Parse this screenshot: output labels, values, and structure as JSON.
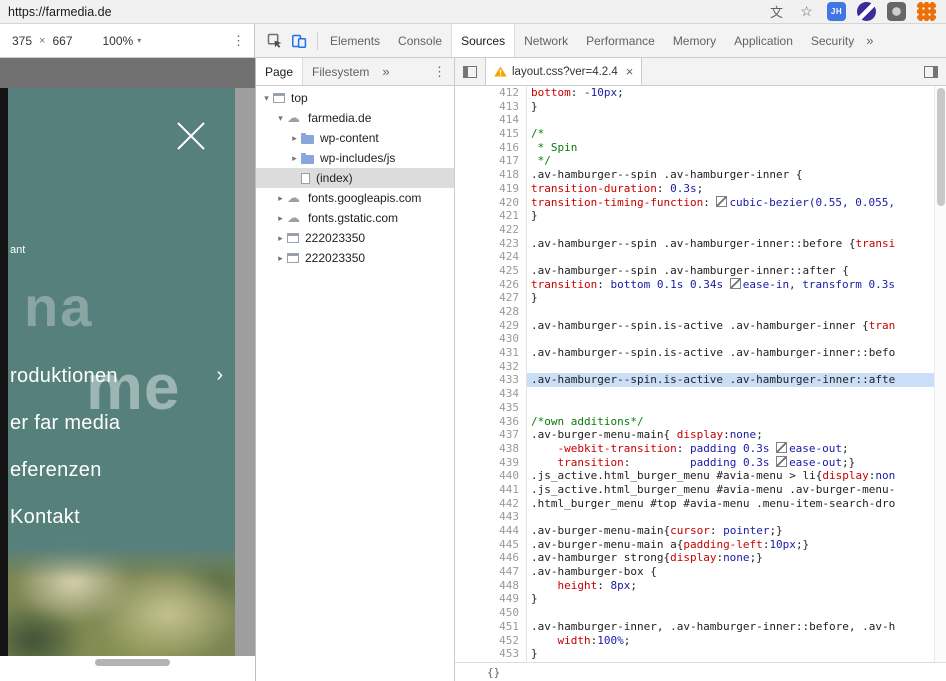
{
  "browser": {
    "url": "https://farmedia.de",
    "icons": [
      {
        "name": "translate-icon",
        "glyph": "文"
      },
      {
        "name": "star-icon",
        "glyph": "☆"
      },
      {
        "name": "extension-icon-jh",
        "glyph": "JH"
      },
      {
        "name": "extension-icon-purple",
        "glyph": ""
      },
      {
        "name": "extension-icon-gray",
        "glyph": ""
      },
      {
        "name": "extension-icon-orange",
        "glyph": ""
      }
    ]
  },
  "glyphs": {
    "times": "×",
    "caret": "▾",
    "kebab": "⋮",
    "overflow": "»",
    "close": "×",
    "chevron": "›",
    "expander_open": "▾",
    "expander_closed": "▸"
  },
  "device_toolbar": {
    "width": "375",
    "height": "667",
    "zoom": "100%"
  },
  "devtools": {
    "tabs": [
      "Elements",
      "Console",
      "Sources",
      "Network",
      "Performance",
      "Memory",
      "Application",
      "Security"
    ],
    "active_tab": "Sources"
  },
  "sidebar": {
    "tabs": [
      "Page",
      "Filesystem"
    ],
    "active_tab": "Page",
    "tree": [
      {
        "label": "top",
        "icon": "frame",
        "depth": 0,
        "exp": "open"
      },
      {
        "label": "farmedia.de",
        "icon": "cloud",
        "depth": 1,
        "exp": "open"
      },
      {
        "label": "wp-content",
        "icon": "folder",
        "depth": 2,
        "exp": "closed"
      },
      {
        "label": "wp-includes/js",
        "icon": "folder",
        "depth": 2,
        "exp": "closed"
      },
      {
        "label": "(index)",
        "icon": "page",
        "depth": 2,
        "exp": "",
        "selected": true
      },
      {
        "label": "fonts.googleapis.com",
        "icon": "cloud",
        "depth": 1,
        "exp": "closed"
      },
      {
        "label": "fonts.gstatic.com",
        "icon": "cloud",
        "depth": 1,
        "exp": "closed"
      },
      {
        "label": "222023350",
        "icon": "frame",
        "depth": 1,
        "exp": "closed"
      },
      {
        "label": "222023350",
        "icon": "frame",
        "depth": 1,
        "exp": "closed"
      }
    ]
  },
  "editor": {
    "tab": {
      "label": "layout.css?ver=4.2.4"
    },
    "pretty_print_label": "{}",
    "lines": [
      {
        "n": 412,
        "t": [
          [
            "k",
            "bottom"
          ],
          [
            "p",
            ": "
          ],
          [
            "v",
            "-10px"
          ],
          [
            "p",
            ";"
          ]
        ]
      },
      {
        "n": 413,
        "t": [
          [
            "p",
            "}"
          ]
        ]
      },
      {
        "n": 414,
        "t": []
      },
      {
        "n": 415,
        "t": [
          [
            "c",
            "/*"
          ]
        ]
      },
      {
        "n": 416,
        "t": [
          [
            "c",
            " * Spin"
          ]
        ]
      },
      {
        "n": 417,
        "t": [
          [
            "c",
            " */"
          ]
        ]
      },
      {
        "n": 418,
        "t": [
          [
            "p",
            ".av-hamburger--spin .av-hamburger-inner {"
          ]
        ]
      },
      {
        "n": 419,
        "t": [
          [
            "k",
            "transition-duration"
          ],
          [
            "p",
            ": "
          ],
          [
            "v",
            "0.3s"
          ],
          [
            "p",
            ";"
          ]
        ]
      },
      {
        "n": 420,
        "t": [
          [
            "k",
            "transition-timing-function"
          ],
          [
            "p",
            ": "
          ],
          [
            "sw",
            ""
          ],
          [
            "v",
            "cubic-bezier(0.55, 0.055,"
          ]
        ]
      },
      {
        "n": 421,
        "t": [
          [
            "p",
            "}"
          ]
        ]
      },
      {
        "n": 422,
        "t": []
      },
      {
        "n": 423,
        "t": [
          [
            "p",
            ".av-hamburger--spin .av-hamburger-inner::before {"
          ],
          [
            "k",
            "transi"
          ]
        ]
      },
      {
        "n": 424,
        "t": []
      },
      {
        "n": 425,
        "t": [
          [
            "p",
            ".av-hamburger--spin .av-hamburger-inner::after {"
          ]
        ]
      },
      {
        "n": 426,
        "t": [
          [
            "k",
            "transition"
          ],
          [
            "p",
            ": "
          ],
          [
            "v",
            "bottom 0.1s 0.34s "
          ],
          [
            "sw",
            ""
          ],
          [
            "v",
            "ease-in, transform 0.3s"
          ]
        ]
      },
      {
        "n": 427,
        "t": [
          [
            "p",
            "}"
          ]
        ]
      },
      {
        "n": 428,
        "t": []
      },
      {
        "n": 429,
        "t": [
          [
            "p",
            ".av-hamburger--spin.is-active .av-hamburger-inner {"
          ],
          [
            "k",
            "tran"
          ]
        ]
      },
      {
        "n": 430,
        "t": []
      },
      {
        "n": 431,
        "t": [
          [
            "p",
            ".av-hamburger--spin.is-active .av-hamburger-inner::befo"
          ]
        ]
      },
      {
        "n": 432,
        "t": []
      },
      {
        "n": 433,
        "hl": true,
        "t": [
          [
            "p",
            ".av-hamburger--spin.is-active .av-hamburger-inner::afte"
          ]
        ]
      },
      {
        "n": 434,
        "t": []
      },
      {
        "n": 435,
        "t": []
      },
      {
        "n": 436,
        "t": [
          [
            "c",
            "/*own additions*/"
          ]
        ]
      },
      {
        "n": 437,
        "t": [
          [
            "p",
            ".av-burger-menu-main{ "
          ],
          [
            "k",
            "display"
          ],
          [
            "p",
            ":"
          ],
          [
            "v",
            "none"
          ],
          [
            "p",
            ";"
          ]
        ]
      },
      {
        "n": 438,
        "t": [
          [
            "p",
            "    "
          ],
          [
            "k",
            "-webkit-transition"
          ],
          [
            "p",
            ": "
          ],
          [
            "v",
            "padding 0.3s "
          ],
          [
            "sw",
            ""
          ],
          [
            "v",
            "ease-out"
          ],
          [
            "p",
            ";"
          ]
        ]
      },
      {
        "n": 439,
        "t": [
          [
            "p",
            "    "
          ],
          [
            "k",
            "transition"
          ],
          [
            "p",
            ":         "
          ],
          [
            "v",
            "padding 0.3s "
          ],
          [
            "sw",
            ""
          ],
          [
            "v",
            "ease-out"
          ],
          [
            "p",
            ";}"
          ]
        ]
      },
      {
        "n": 440,
        "t": [
          [
            "p",
            ".js_active.html_burger_menu #avia-menu > li{"
          ],
          [
            "k",
            "display"
          ],
          [
            "p",
            ":"
          ],
          [
            "v",
            "non"
          ]
        ]
      },
      {
        "n": 441,
        "t": [
          [
            "p",
            ".js_active.html_burger_menu #avia-menu .av-burger-menu-"
          ]
        ]
      },
      {
        "n": 442,
        "t": [
          [
            "p",
            ".html_burger_menu #top #avia-menu .menu-item-search-dro"
          ]
        ]
      },
      {
        "n": 443,
        "t": []
      },
      {
        "n": 444,
        "t": [
          [
            "p",
            ".av-burger-menu-main{"
          ],
          [
            "k",
            "cursor"
          ],
          [
            "p",
            ": "
          ],
          [
            "v",
            "pointer"
          ],
          [
            "p",
            ";}"
          ]
        ]
      },
      {
        "n": 445,
        "t": [
          [
            "p",
            ".av-burger-menu-main a{"
          ],
          [
            "k",
            "padding-left"
          ],
          [
            "p",
            ":"
          ],
          [
            "v",
            "10px"
          ],
          [
            "p",
            ";}"
          ]
        ]
      },
      {
        "n": 446,
        "t": [
          [
            "p",
            ".av-hamburger strong{"
          ],
          [
            "k",
            "display"
          ],
          [
            "p",
            ":"
          ],
          [
            "v",
            "none"
          ],
          [
            "p",
            ";}"
          ]
        ]
      },
      {
        "n": 447,
        "t": [
          [
            "p",
            ".av-hamburger-box {"
          ]
        ]
      },
      {
        "n": 448,
        "t": [
          [
            "p",
            "    "
          ],
          [
            "k",
            "height"
          ],
          [
            "p",
            ": "
          ],
          [
            "v",
            "8px"
          ],
          [
            "p",
            ";"
          ]
        ]
      },
      {
        "n": 449,
        "t": [
          [
            "p",
            "}"
          ]
        ]
      },
      {
        "n": 450,
        "t": []
      },
      {
        "n": 451,
        "t": [
          [
            "p",
            ".av-hamburger-inner, .av-hamburger-inner::before, .av-h"
          ]
        ]
      },
      {
        "n": 452,
        "t": [
          [
            "p",
            "    "
          ],
          [
            "k",
            "width"
          ],
          [
            "p",
            ":"
          ],
          [
            "v",
            "100%"
          ],
          [
            "p",
            ";"
          ]
        ]
      },
      {
        "n": 453,
        "t": [
          [
            "p",
            "}"
          ]
        ]
      }
    ]
  },
  "page_preview": {
    "small_text": "ant",
    "watermark_1": "na",
    "watermark_2": "me",
    "menu_items": [
      "roduktionen",
      "er far media",
      "eferenzen",
      "Kontakt"
    ]
  }
}
